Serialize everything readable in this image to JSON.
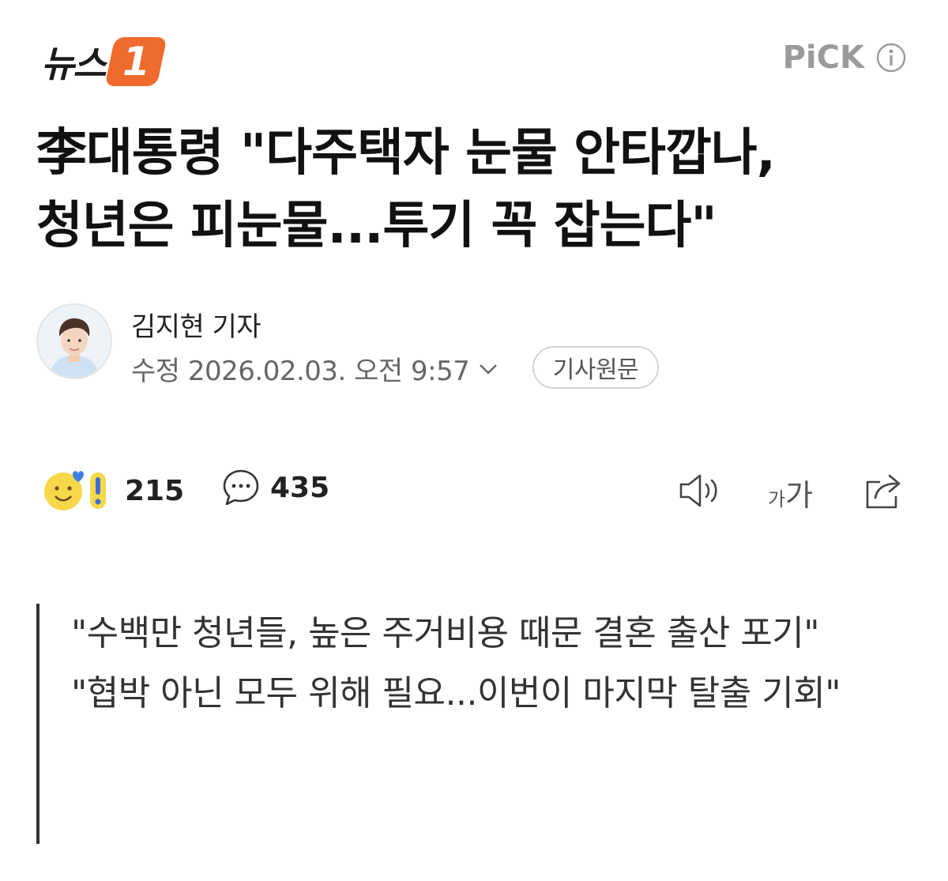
{
  "header": {
    "brand_text": "뉴스",
    "brand_badge": "1",
    "pick_label": "PiCK"
  },
  "article": {
    "headline_line1": "李대통령 \"다주택자 눈물 안타깝나,",
    "headline_line2": "청년은 피눈물...투기 꼭 잡는다\"",
    "author": "김지현 기자",
    "modified": "수정 2026.02.03. 오전 9:57",
    "original_button": "기사원문"
  },
  "engagement": {
    "reactions_count": "215",
    "comments_count": "435",
    "font_size_small": "가",
    "font_size_big": "가"
  },
  "summary": [
    "\"수백만 청년들, 높은 주거비용 때문 결혼 출산 포기\"",
    "\"협박 아닌 모두 위해 필요...이번이 마지막 탈출 기회\""
  ],
  "colors": {
    "brand_orange": "#ef6b2d",
    "pick_gray": "#9a9a9a"
  }
}
